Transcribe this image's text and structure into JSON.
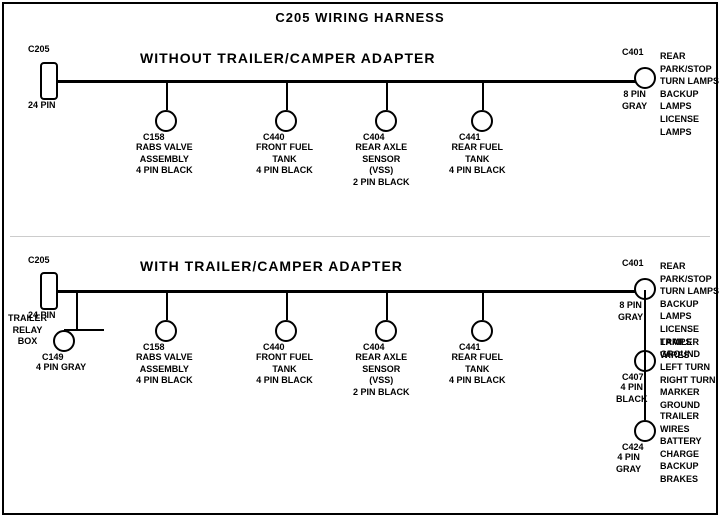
{
  "title": "C205 WIRING HARNESS",
  "top_section": {
    "label": "WITHOUT TRAILER/CAMPER ADAPTER",
    "left_connector": {
      "id": "C205",
      "pin": "24 PIN"
    },
    "right_connector": {
      "id": "C401",
      "pin": "8 PIN\nGRAY",
      "label": "REAR PARK/STOP\nTURN LAMPS\nBACKUP LAMPS\nLICENSE LAMPS"
    },
    "connectors": [
      {
        "id": "C158",
        "label": "RABS VALVE\nASSEMBLY\n4 PIN BLACK"
      },
      {
        "id": "C440",
        "label": "FRONT FUEL\nTANK\n4 PIN BLACK"
      },
      {
        "id": "C404",
        "label": "REAR AXLE\nSENSOR\n(VSS)\n2 PIN BLACK"
      },
      {
        "id": "C441",
        "label": "REAR FUEL\nTANK\n4 PIN BLACK"
      }
    ]
  },
  "bottom_section": {
    "label": "WITH TRAILER/CAMPER ADAPTER",
    "left_connector": {
      "id": "C205",
      "pin": "24 PIN"
    },
    "extra_connector": {
      "id": "C149",
      "label": "TRAILER\nRELAY\nBOX",
      "pin": "4 PIN GRAY"
    },
    "right_connector": {
      "id": "C401",
      "pin": "8 PIN\nGRAY",
      "label": "REAR PARK/STOP\nTURN LAMPS\nBACKUP LAMPS\nLICENSE LAMPS\nGROUND"
    },
    "right_connector2": {
      "id": "C407",
      "pin": "4 PIN\nBLACK",
      "label": "TRAILER WIRES\nLEFT TURN\nRIGHT TURN\nMARKER\nGROUND"
    },
    "right_connector3": {
      "id": "C424",
      "pin": "4 PIN\nGRAY",
      "label": "TRAILER WIRES\nBATTERY CHARGE\nBACKUP\nBRAKES"
    },
    "connectors": [
      {
        "id": "C158",
        "label": "RABS VALVE\nASSEMBLY\n4 PIN BLACK"
      },
      {
        "id": "C440",
        "label": "FRONT FUEL\nTANK\n4 PIN BLACK"
      },
      {
        "id": "C404",
        "label": "REAR AXLE\nSENSOR\n(VSS)\n2 PIN BLACK"
      },
      {
        "id": "C441",
        "label": "REAR FUEL\nTANK\n4 PIN BLACK"
      }
    ]
  }
}
